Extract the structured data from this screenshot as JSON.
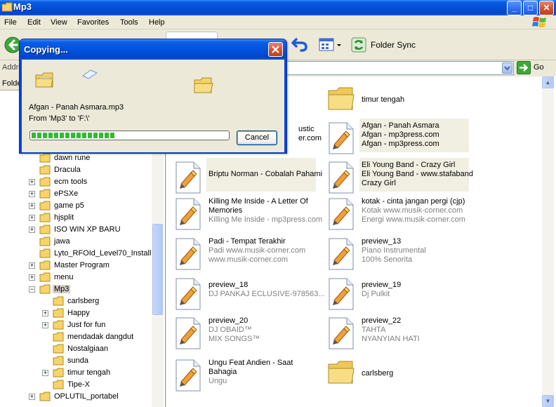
{
  "window": {
    "title": "Mp3",
    "minimize": "_",
    "maximize": "□",
    "close": "✕"
  },
  "menu": [
    "File",
    "Edit",
    "View",
    "Favorites",
    "Tools",
    "Help"
  ],
  "toolbar": {
    "folder_sync_label": "Folder Sync"
  },
  "address": {
    "label": "Addre",
    "go_label": "Go"
  },
  "folders_pane": {
    "header": "Folde"
  },
  "tree": [
    {
      "label": "dawn rune",
      "expander": ""
    },
    {
      "label": "Dracula",
      "expander": ""
    },
    {
      "label": "ecm tools",
      "expander": "+"
    },
    {
      "label": "ePSXe",
      "expander": "+"
    },
    {
      "label": "game p5",
      "expander": "+"
    },
    {
      "label": "hjsplit",
      "expander": "+"
    },
    {
      "label": "ISO WIN XP BARU",
      "expander": "+"
    },
    {
      "label": "jawa",
      "expander": ""
    },
    {
      "label": "Lyto_RFOId_Level70_Install",
      "expander": ""
    },
    {
      "label": "Master Program",
      "expander": "+"
    },
    {
      "label": "menu",
      "expander": "+"
    },
    {
      "label": "Mp3",
      "expander": "−",
      "selected": true
    },
    {
      "label": "carlsberg",
      "expander": ""
    },
    {
      "label": "Happy",
      "expander": "+"
    },
    {
      "label": "Just for fun",
      "expander": "+"
    },
    {
      "label": "mendadak dangdut",
      "expander": ""
    },
    {
      "label": "Nostalgiaan",
      "expander": ""
    },
    {
      "label": "sunda",
      "expander": ""
    },
    {
      "label": "timur tengah",
      "expander": "+"
    },
    {
      "label": "Tipe-X",
      "expander": ""
    },
    {
      "label": "OPLUTIL_portabel",
      "expander": "+"
    }
  ],
  "files": [
    {
      "lines": [
        "timur tengah"
      ],
      "type": "folder"
    },
    {
      "lines": [
        "ustic",
        "er.com"
      ],
      "type": "audio-partial"
    },
    {
      "lines": [
        "Afgan - Panah Asmara",
        "Afgan - mp3press.com",
        "Afgan - mp3press.com"
      ],
      "type": "audio",
      "highlighted": true
    },
    {
      "lines": [
        "Briptu Norman - Cobalah Pahami"
      ],
      "type": "audio",
      "highlighted": true
    },
    {
      "lines": [
        "Eli Young Band - Crazy Girl",
        "Eli Young Band - www.stafaband",
        "Crazy Girl"
      ],
      "type": "audio",
      "highlighted": true
    },
    {
      "lines": [
        "Killing Me Inside - A Letter Of",
        "Memories",
        " Killing Me Inside - mp3press.com"
      ],
      "type": "audio"
    },
    {
      "lines": [
        "kotak - cinta jangan pergi (cjp)",
        "Kotak www.musik-corner.com",
        "Energi www.musik-corner.com"
      ],
      "type": "audio"
    },
    {
      "lines": [
        "Padi - Tempat Terakhir",
        "Padi www.musik-corner.com",
        "www.musik-corner.com"
      ],
      "type": "audio"
    },
    {
      "lines": [
        "preview_13",
        "Piano Instrumental",
        "100% Senorita"
      ],
      "type": "audio"
    },
    {
      "lines": [
        "preview_18",
        "DJ PANKAJ ECLUSIVE-978563..."
      ],
      "type": "audio"
    },
    {
      "lines": [
        "preview_19",
        "Dj Pulkit"
      ],
      "type": "audio"
    },
    {
      "lines": [
        "preview_20",
        "DJ OBAID™",
        "MIX SONGS™"
      ],
      "type": "audio"
    },
    {
      "lines": [
        "preview_22",
        "TAHTA",
        "NYANYIAN HATI"
      ],
      "type": "audio"
    },
    {
      "lines": [
        "Ungu Feat Andien - Saat",
        "Bahagia",
        "Ungu"
      ],
      "type": "audio"
    },
    {
      "lines": [
        "carlsberg"
      ],
      "type": "folder"
    }
  ],
  "dialog": {
    "title": "Copying...",
    "file_name": "Afgan - Panah Asmara.mp3",
    "from_to": "From 'Mp3' to 'F:\\'",
    "progress": 0.43,
    "cancel_label": "Cancel"
  },
  "colors": {
    "title_blue": "#0050d8",
    "progress_green": "#37b835",
    "highlight": "#f1efe2",
    "secondary_text": "#808080"
  }
}
